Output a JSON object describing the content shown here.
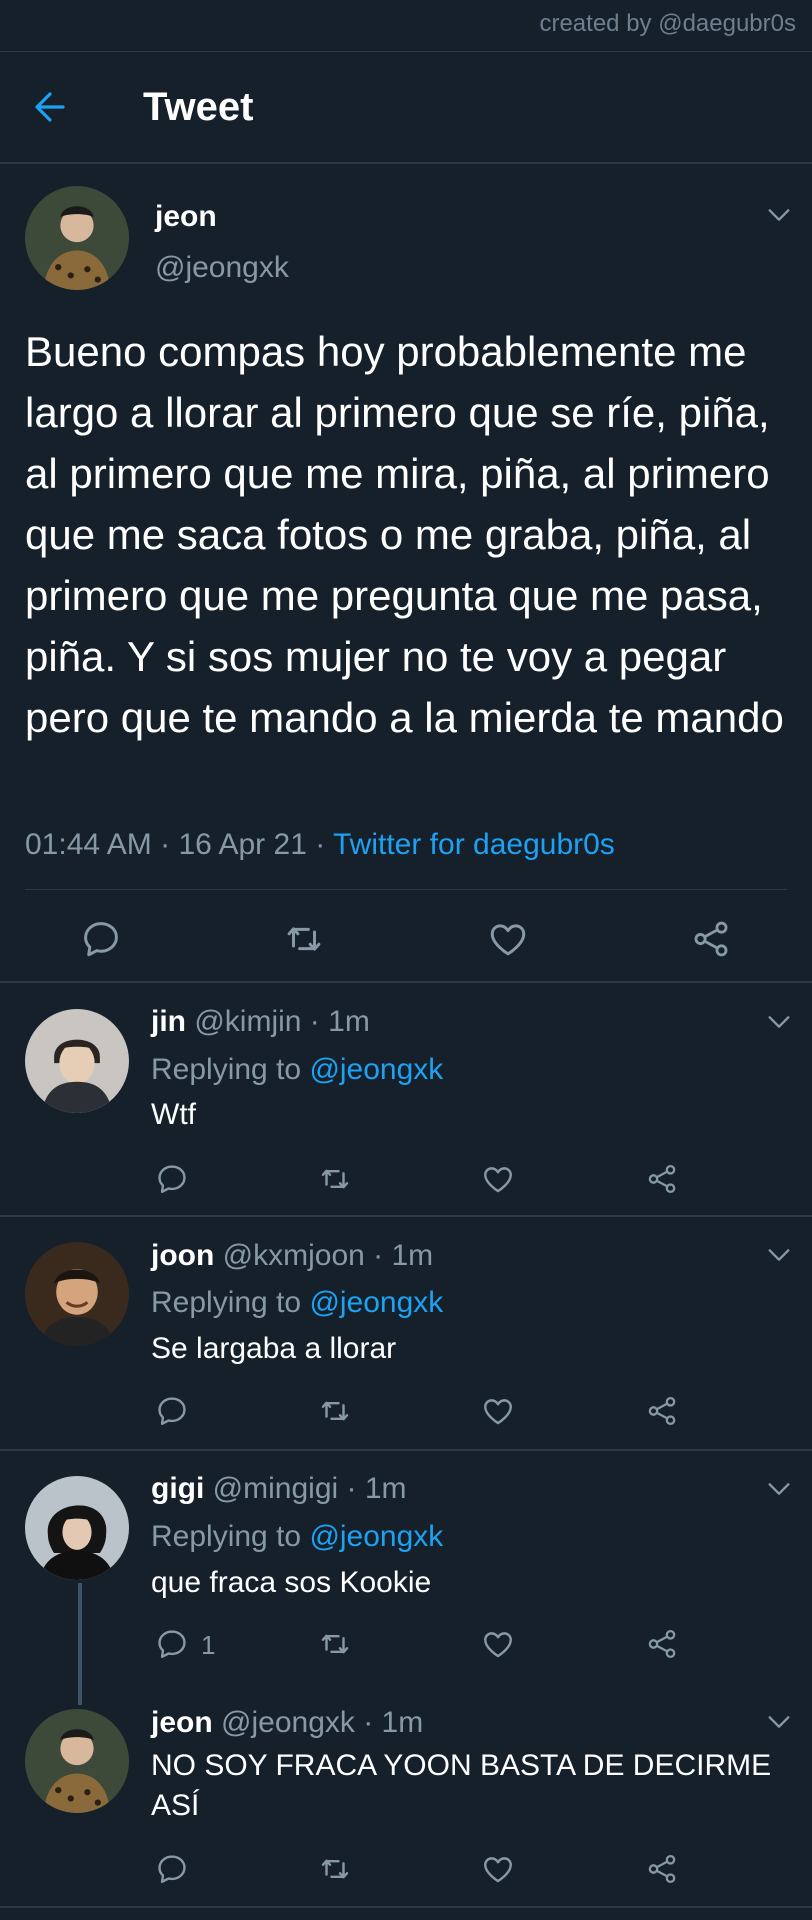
{
  "credit": "created by @daegubr0s",
  "header": {
    "title": "Tweet"
  },
  "main_tweet": {
    "name": "jeon",
    "handle": "@jeongxk",
    "text": "Bueno compas hoy probablemente me largo a llorar al primero que se ríe, piña, al primero que me mira, piña, al primero que me saca fotos o me graba, piña, al primero que me pregunta que me pasa, piña. Y si sos mujer no te voy a pegar pero que te mando a la mierda te mando",
    "time": "01:44 AM",
    "date": "16 Apr 21",
    "source": "Twitter for daegubr0s"
  },
  "replies": [
    {
      "name": "jin",
      "handle": "@kimjin",
      "time": "1m",
      "replying_label": "Replying to",
      "replying_to": "@jeongxk",
      "text": "Wtf",
      "reply_count": ""
    },
    {
      "name": "joon",
      "handle": "@kxmjoon",
      "time": "1m",
      "replying_label": "Replying to",
      "replying_to": "@jeongxk",
      "text": "Se largaba a llorar",
      "reply_count": ""
    },
    {
      "name": "gigi",
      "handle": "@mingigi",
      "time": "1m",
      "replying_label": "Replying to",
      "replying_to": "@jeongxk",
      "text": "que fraca sos Kookie",
      "reply_count": "1"
    },
    {
      "name": "jeon",
      "handle": "@jeongxk",
      "time": "1m",
      "text": "NO SOY FRACA YOON BASTA DE DECIRME ASÍ",
      "reply_count": ""
    }
  ],
  "colors": {
    "background": "#15202b",
    "accent": "#1da1f2",
    "muted": "#8899a6",
    "divider": "#2b3945"
  },
  "icons": [
    "back-arrow-icon",
    "chevron-down-icon",
    "reply-icon",
    "retweet-icon",
    "like-icon",
    "share-icon"
  ]
}
